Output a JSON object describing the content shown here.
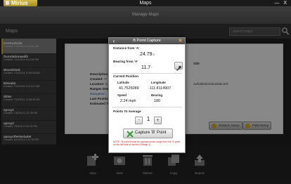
{
  "titlebar": {
    "app_name": "Mirius",
    "window_title": "Maps",
    "controls": [
      "—",
      "X"
    ]
  },
  "header": {
    "title": "Manage Maps"
  },
  "toolbar": {
    "section_title": "Maps",
    "search_placeholder": "search maps"
  },
  "maps_list": [
    {
      "name": "leveloutside",
      "date": "Created: 7/13/2014 4:03:41 AM"
    },
    {
      "name": "foundationwall2",
      "date": "Created: 7/12/2014 5:14:48 PM"
    },
    {
      "name": "Woodshed",
      "date": "Created: 7/11/2014 10:56:06 AM"
    },
    {
      "name": "Elevatio",
      "date": "Created: 7/11/2014 11:21:07 AM"
    },
    {
      "name": "ditter",
      "date": "Created: 7/11/2014 11:59:30 AM"
    },
    {
      "name": "spray1",
      "date": "Created: 7/8/2014 1:21:36 PM"
    },
    {
      "name": "spray2",
      "date": "Created: 7/9/2014 5:02:31 PM"
    },
    {
      "name": "spraycftertesladet",
      "date": "Created: 8/15/2014 1:07:30 PM"
    }
  ],
  "details": {
    "description_label": "Description",
    "created_label": "Created:",
    "created_value": "7/",
    "location_label": "Location:",
    "location_value": "C",
    "ranges_label": "Ranges Des",
    "navigation_label": "Navigation",
    "last_position_label": "Last Positio",
    "estimated_label": "Estimated Ti",
    "right_title": "side",
    "right_file": "ewfolderleveloutside.tmf",
    "buttons": [
      "Session Setup",
      "Field Setup"
    ]
  },
  "bottombar": {
    "items": [
      {
        "label": "New",
        "icon": "new-map-icon"
      },
      {
        "label": "View",
        "icon": "view-map-icon"
      },
      {
        "label": "Delete",
        "icon": "trash-icon"
      },
      {
        "label": "Copy",
        "icon": "copy-icon"
      },
      {
        "label": "Export",
        "icon": "export-icon"
      }
    ]
  },
  "modal": {
    "title": "B Point Capture",
    "distance_label": "Distance from 'A'",
    "distance_value": "24.79",
    "distance_unit": "ft",
    "bearing_label": "Bearing from 'A'",
    "bearing_value": "11.7",
    "bearing_unit": "°",
    "current_position_label": "Current Position",
    "latitude_label": "Latitude",
    "latitude_value": "41.7525089",
    "longitude_label": "Longitude",
    "longitude_value": "-111.8114907",
    "speed_label": "Speed",
    "speed_value": "2.24 mph",
    "bearing2_label": "Bearing",
    "bearing2_value": "180",
    "points_label": "Points To Average",
    "points_value": "1",
    "minus": "-",
    "plus": "+",
    "capture_label": "Capture 'B' Point",
    "note": "NOTE: 'B' point should be captured down range from the 'A' point on the left side of the field (Range 1)"
  },
  "colors": {
    "accent": "#c8a82a",
    "note_red": "#cc1f1f",
    "capture_icon_green": "#3a9b3a"
  }
}
